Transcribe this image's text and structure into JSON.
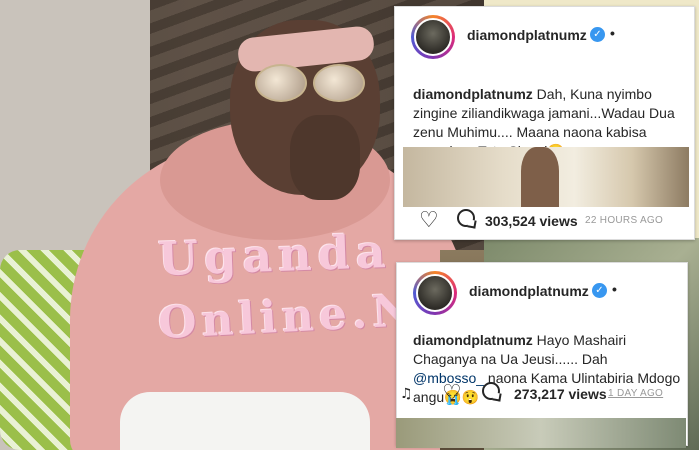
{
  "watermark": {
    "line1": "Uganda",
    "line2": "Online.Net"
  },
  "post1": {
    "username": "diamondplatnumz",
    "verified_glyph": "✓",
    "more": "•",
    "caption_user": "diamondplatnumz",
    "caption_text": " Dah, Kuna nyimbo zingine ziliandikwaga jamani...Wadau Dua zenu Muhimu.... Maana naona kabisa mwezi wa Tatu Siuoni😭",
    "views": "303,524 views",
    "time_ago": "22 HOURS AGO"
  },
  "post2": {
    "username": "diamondplatnumz",
    "verified_glyph": "✓",
    "more": "•",
    "caption_user": "diamondplatnumz",
    "caption_text": " Hayo Mashairi Chaganya na Ua Jeusi...... Dah ",
    "mention": "@mbosso_",
    "caption_text_end": " naona Kama Ulintabiria Mdogo angu😭😲",
    "music_glyph": "♫",
    "views": "273,217 views",
    "time_ago": "1 DAY AGO"
  },
  "icons": {
    "heart": "♡"
  }
}
